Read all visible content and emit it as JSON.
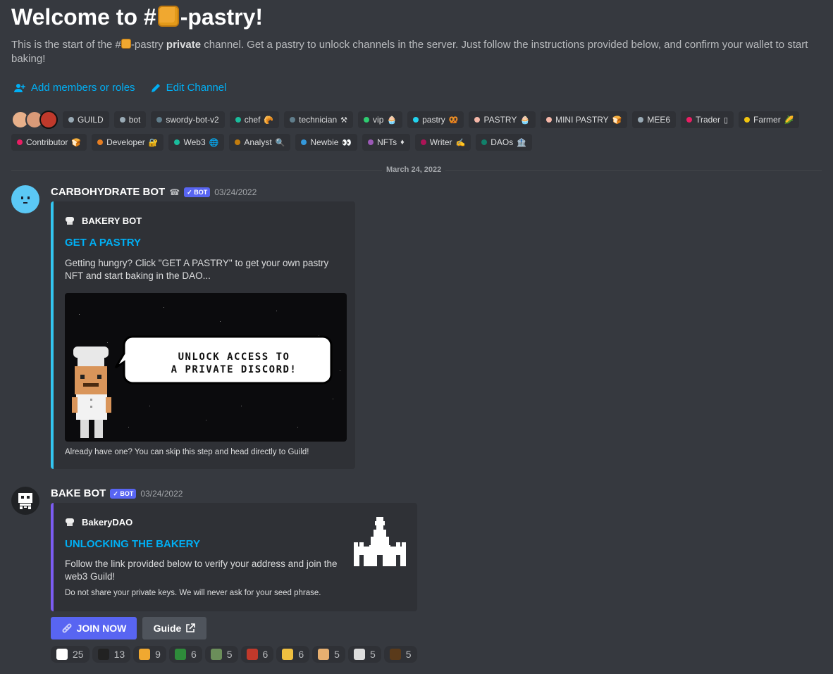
{
  "header": {
    "title_prefix": "Welcome to #",
    "title_suffix": "-pastry!",
    "intro_a": "This is the start of the #",
    "intro_b": "-pastry ",
    "intro_bold": "private",
    "intro_c": " channel. Get a pastry to unlock channels in the server. Just follow the instructions provided below, and confirm your wallet to start baking!",
    "add_members": "Add members or roles",
    "edit_channel": "Edit Channel"
  },
  "roles_row1": [
    {
      "label": "GUILD",
      "color": "#99aab5",
      "emoji": ""
    },
    {
      "label": "bot",
      "color": "#99aab5",
      "emoji": ""
    },
    {
      "label": "swordy-bot-v2",
      "color": "#607d8b",
      "emoji": ""
    },
    {
      "label": "chef",
      "color": "#1abc9c",
      "emoji": "🥐"
    },
    {
      "label": "technician",
      "color": "#607d8b",
      "emoji": "⚒"
    },
    {
      "label": "vip",
      "color": "#2ecc71",
      "emoji": "🧁"
    },
    {
      "label": "pastry",
      "color": "#22d3ee",
      "emoji": "🥨"
    },
    {
      "label": "PASTRY",
      "color": "#f5b7a8",
      "emoji": "🧁"
    },
    {
      "label": "MINI PASTRY",
      "color": "#f5b7a8",
      "emoji": "🍞"
    },
    {
      "label": "MEE6",
      "color": "#99aab5",
      "emoji": ""
    },
    {
      "label": "Trader",
      "color": "#e91e63",
      "emoji": "▯"
    },
    {
      "label": "Farmer",
      "color": "#f1c40f",
      "emoji": "🌽"
    }
  ],
  "roles_row2": [
    {
      "label": "Contributor",
      "color": "#e91e63",
      "emoji": "🍞"
    },
    {
      "label": "Developer",
      "color": "#e67e22",
      "emoji": "🔐"
    },
    {
      "label": "Web3",
      "color": "#1abc9c",
      "emoji": "🌐"
    },
    {
      "label": "Analyst",
      "color": "#c27c0e",
      "emoji": "🔍"
    },
    {
      "label": "Newbie",
      "color": "#3498db",
      "emoji": "👀"
    },
    {
      "label": "NFTs",
      "color": "#9b59b6",
      "emoji": "♦"
    },
    {
      "label": "Writer",
      "color": "#ad1457",
      "emoji": "✍"
    },
    {
      "label": "DAOs",
      "color": "#11806a",
      "emoji": "🏦"
    }
  ],
  "date_divider": "March 24, 2022",
  "msg1": {
    "author": "CARBOHYDRATE BOT",
    "author_emoji": "☎",
    "bot_tag": "✓ BOT",
    "timestamp": "03/24/2022",
    "embed_author": "BAKERY BOT",
    "embed_title": "GET A PASTRY",
    "embed_desc": "Getting hungry? Click \"GET A PASTRY\" to get your own pastry NFT and start baking in the DAO...",
    "image_text_1": "UNLOCK ACCESS TO",
    "image_text_2": "A PRIVATE DISCORD!",
    "embed_footer": "Already have one? You can skip this step and head directly to Guild!"
  },
  "msg2": {
    "author": "BAKE BOT",
    "bot_tag": "✓ BOT",
    "timestamp": "03/24/2022",
    "embed_author": "BakeryDAO",
    "embed_title": "UNLOCKING THE BAKERY",
    "embed_desc": "Follow the link provided below to verify your address and join the web3 Guild!",
    "embed_footer": "Do not share your private keys. We will never ask for your seed phrase.",
    "join_button": "JOIN NOW",
    "guide_button": "Guide"
  },
  "reactions": [
    {
      "count": "25",
      "color": "#ffffff"
    },
    {
      "count": "13",
      "color": "#222222"
    },
    {
      "count": "9",
      "color": "#f0a830"
    },
    {
      "count": "6",
      "color": "#2e8b3a"
    },
    {
      "count": "5",
      "color": "#6b8e5a"
    },
    {
      "count": "6",
      "color": "#c0392b"
    },
    {
      "count": "6",
      "color": "#f0c040"
    },
    {
      "count": "5",
      "color": "#e8b070"
    },
    {
      "count": "5",
      "color": "#dddddd"
    },
    {
      "count": "5",
      "color": "#5a3a1a"
    }
  ],
  "colors": {
    "background": "#36393f",
    "embed_bg": "#2f3136",
    "link": "#00aff4",
    "embed1_border": "#33c5f0",
    "embed2_border": "#7c5cf2",
    "join_button": "#5865f2",
    "guide_button": "#4f545c"
  }
}
